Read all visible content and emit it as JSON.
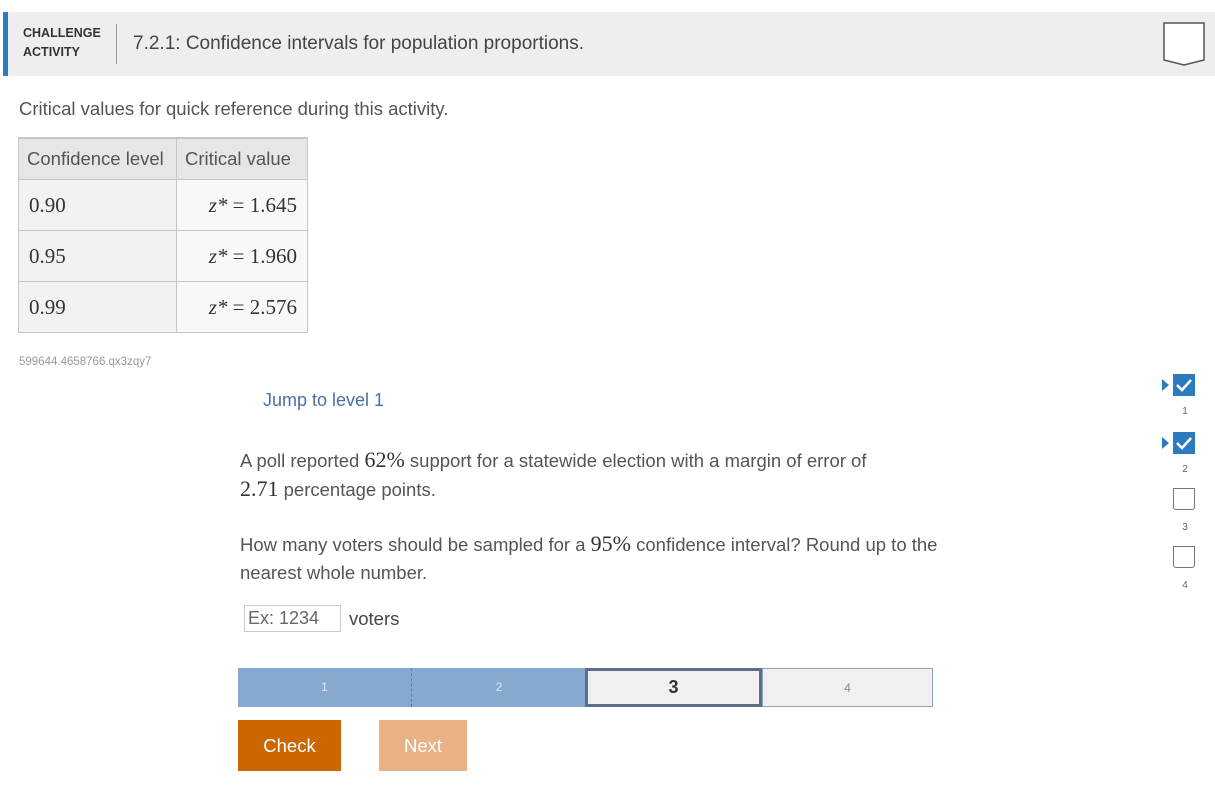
{
  "header": {
    "label_line1": "CHALLENGE",
    "label_line2": "ACTIVITY",
    "title": "7.2.1: Confidence intervals for population proportions."
  },
  "intro": "Critical values for quick reference during this activity.",
  "table": {
    "headers": [
      "Confidence level",
      "Critical value"
    ],
    "rows": [
      {
        "level": "0.90",
        "value": "1.645"
      },
      {
        "level": "0.95",
        "value": "1.960"
      },
      {
        "level": "0.99",
        "value": "2.576"
      }
    ],
    "z_symbol": "z*",
    "equals": "="
  },
  "activity_code": "599644.4658766.qx3zqy7",
  "jump_link": "Jump to level 1",
  "question": {
    "p1_a": "A poll reported ",
    "p1_pct": "62%",
    "p1_b": " support for a statewide election with a margin of error of",
    "p1_moe": "2.71",
    "p1_c": " percentage points.",
    "p2_a": "How many voters should be sampled for a ",
    "p2_pct": "95%",
    "p2_b": " confidence interval? Round up to the nearest whole number."
  },
  "answer": {
    "placeholder": "Ex: 1234",
    "unit": "voters"
  },
  "progress": {
    "levels": [
      "1",
      "2",
      "3",
      "4"
    ],
    "current": 3,
    "completed": 2
  },
  "buttons": {
    "check": "Check",
    "next": "Next"
  },
  "side_levels": [
    "1",
    "2",
    "3",
    "4"
  ],
  "colors": {
    "accent": "#2a7bc0",
    "check": "#cc6600",
    "next": "#e8b286",
    "progress_done": "#86a9cf"
  }
}
